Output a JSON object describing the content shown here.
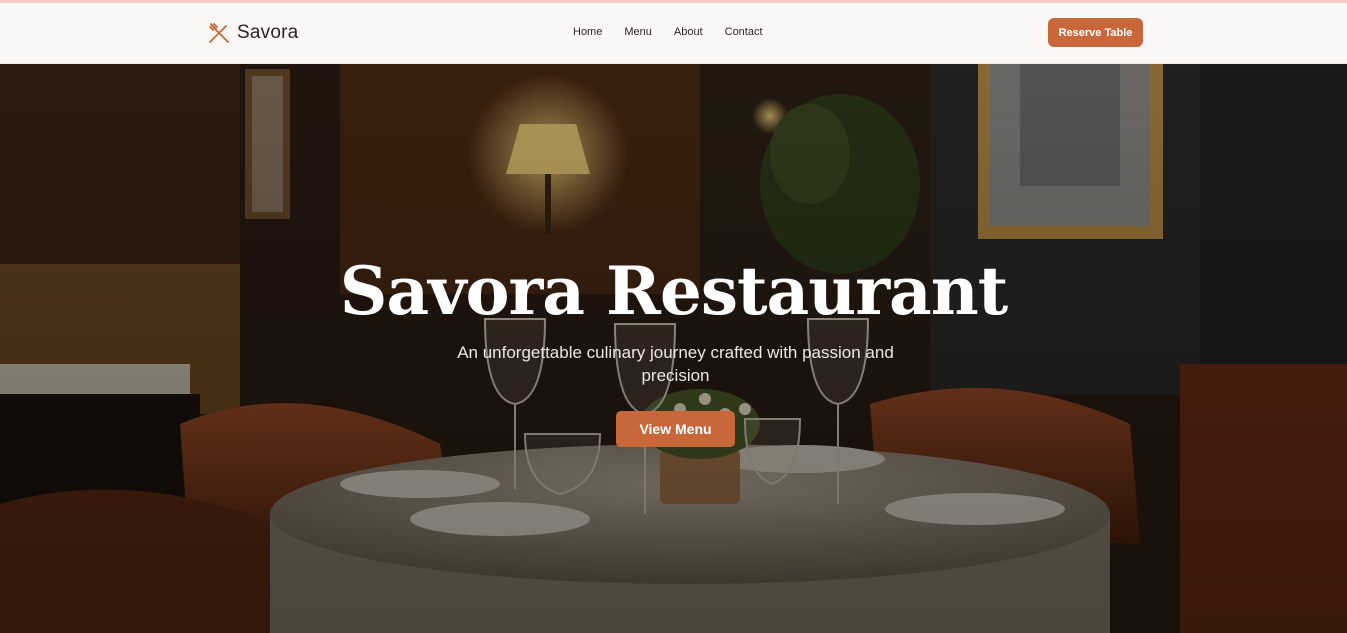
{
  "brand": {
    "name": "Savora",
    "logo_icon": "fork-knife-icon",
    "accent": "#c8683a"
  },
  "nav": {
    "links": [
      "Home",
      "Menu",
      "About",
      "Contact"
    ],
    "cta_label": "Reserve Table"
  },
  "hero": {
    "title": "Savora Restaurant",
    "subtitle": "An unforgettable culinary journey crafted with passion and precision",
    "button_label": "View Menu",
    "background": "dim-restaurant-dining-room-photo"
  }
}
